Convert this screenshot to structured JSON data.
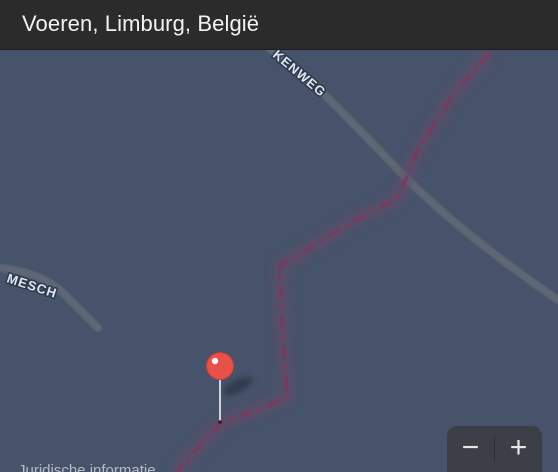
{
  "window": {
    "title": "Voeren, Limburg, België"
  },
  "map": {
    "roads": [
      {
        "name": "KENWEG"
      },
      {
        "name": "MESCH"
      }
    ],
    "boundary_color": "#7b3a5c",
    "background_color": "#47536a",
    "pin": {
      "color": "#e8504a",
      "icon": "map-pin-icon"
    },
    "attribution": "Juridische informatie"
  },
  "zoom_controls": {
    "zoom_out": "−",
    "zoom_in": "+"
  }
}
